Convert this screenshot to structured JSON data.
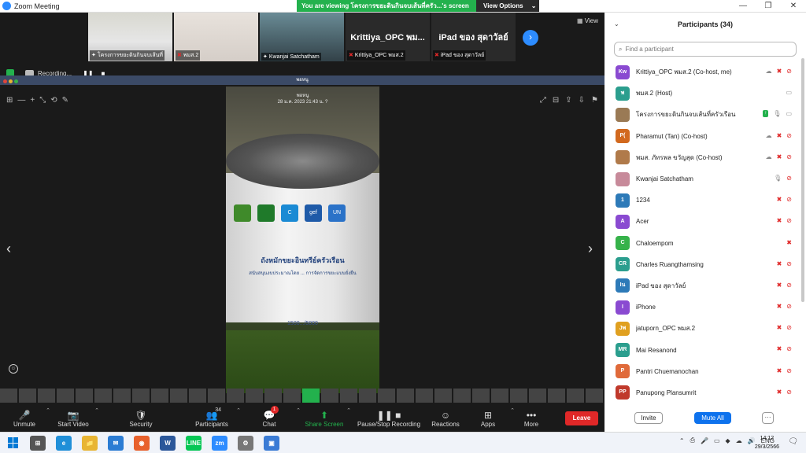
{
  "window": {
    "title": "Zoom Meeting",
    "controls": [
      "—",
      "❐",
      "✕"
    ]
  },
  "share_banner": {
    "message": "You are viewing โครงการขยะดินกินจบเส้นที่ครัว...'s screen",
    "options_label": "View Options",
    "options_caret": "⌄"
  },
  "thumbnails": [
    {
      "label": "โครงการขยะดินกินจบเส้นที่",
      "muted": false
    },
    {
      "label": "พมส.2",
      "muted": true
    },
    {
      "label": "Kwanjai Satchatham",
      "muted": false
    },
    {
      "label": "Krittiya_OPC พมส.2",
      "big_name": "Krittiya_OPC พม...",
      "muted": true
    },
    {
      "label": "iPad ของ สุดาวัลย์",
      "big_name": "iPad ของ สุดาวัลย์",
      "muted": true
    }
  ],
  "thumb_next": "›",
  "view_button": "▦ View",
  "recording": {
    "label": "Recording...",
    "pause": "❚❚",
    "stop": "■"
  },
  "share_title": "พอหนู",
  "shared_caption": {
    "line1": "พอหนู",
    "line2": "28 ม.ค. 2023 21:43 น. ?"
  },
  "bucket": {
    "title": "ถังหมักขยะอินทรีย์ครัวเรือน",
    "subtitle": "สนับสนุนงบประมาณโดย ... การจัดการขยะแบบยั่งยืน",
    "number": "1500.../5000",
    "logos": [
      "gef",
      "C",
      "UN"
    ]
  },
  "share_tools_left": [
    "⊞",
    "—",
    "+",
    "⤡",
    "⟲",
    "✎"
  ],
  "share_tools_right": [
    "⤢",
    "⊟",
    "⇪",
    "⇩",
    "⚑"
  ],
  "nav_left": "‹",
  "nav_right": "›",
  "emoji": "☺",
  "toolbar": {
    "items": [
      {
        "icon": "🎤",
        "label": "Unmute",
        "red": true,
        "caret": "⌃"
      },
      {
        "icon": "📷",
        "label": "Start Video",
        "red": true,
        "caret": "⌃"
      },
      {
        "icon": "🛡",
        "label": "Security"
      },
      {
        "icon": "👥",
        "label": "Participants",
        "count": "34",
        "caret": "⌃"
      },
      {
        "icon": "💬",
        "label": "Chat",
        "badge": "1",
        "caret": "⌃"
      },
      {
        "icon": "⬆",
        "label": "Share Screen",
        "green": true,
        "caret": "⌃"
      },
      {
        "icon": "❚❚ ■",
        "label": "Pause/Stop Recording"
      },
      {
        "icon": "☺",
        "label": "Reactions"
      },
      {
        "icon": "⊞",
        "label": "Apps",
        "caret": "⌃"
      },
      {
        "icon": "•••",
        "label": "More"
      }
    ],
    "leave_label": "Leave"
  },
  "participants_panel": {
    "title": "Participants (34)",
    "collapse": "⌄",
    "search_placeholder": "Find a participant",
    "search_icon": "⌕",
    "participants": [
      {
        "initials": "Kw",
        "name": "Krittiya_OPC พมส.2 (Co-host, me)",
        "color": "#8a4ad1",
        "icons": [
          "cloud",
          "mic-off",
          "video-off"
        ]
      },
      {
        "initials": "พ",
        "name": "พมส.2 (Host)",
        "color": "#2b9e8e",
        "icons": [
          "video"
        ]
      },
      {
        "initials": "",
        "name": "โครงการขยะดินกินจบเส้นที่ครัวเรือน",
        "color": "#9a7a55",
        "icons": [
          "share",
          "mic",
          "video"
        ]
      },
      {
        "initials": "P(",
        "name": "Pharamut (Tan) (Co-host)",
        "color": "#d2691e",
        "icons": [
          "cloud",
          "mic-off",
          "video-off"
        ]
      },
      {
        "initials": "",
        "name": "พมส. ภัทรพล ขวัญสุด (Co-host)",
        "color": "#b07a4a",
        "icons": [
          "cloud",
          "mic-off",
          "video-off"
        ]
      },
      {
        "initials": "",
        "name": "Kwanjai Satchatham",
        "color": "#c78a9a",
        "icons": [
          "mic",
          "video-off"
        ]
      },
      {
        "initials": "1",
        "name": "1234",
        "color": "#2d7ab8",
        "icons": [
          "mic-off",
          "video-off"
        ]
      },
      {
        "initials": "A",
        "name": "Acer",
        "color": "#8a4ad1",
        "icons": [
          "mic-off",
          "video-off"
        ]
      },
      {
        "initials": "C",
        "name": "Chaloempom",
        "color": "#36b24a",
        "icons": [
          "mic-off"
        ]
      },
      {
        "initials": "CR",
        "name": "Charles Ruangthamsing",
        "color": "#2b9e8e",
        "icons": [
          "mic-off",
          "video-off"
        ]
      },
      {
        "initials": "Iน",
        "name": "iPad ของ สุดาวัลย์",
        "color": "#2d7ab8",
        "icons": [
          "mic-off",
          "video-off"
        ]
      },
      {
        "initials": "I",
        "name": "iPhone",
        "color": "#8a4ad1",
        "icons": [
          "mic-off",
          "video-off"
        ]
      },
      {
        "initials": "Jพ",
        "name": "jatuporn_OPC พมส.2",
        "color": "#e0a020",
        "icons": [
          "mic-off",
          "video-off"
        ]
      },
      {
        "initials": "MR",
        "name": "Mai Resanond",
        "color": "#2b9e8e",
        "icons": [
          "mic-off",
          "video-off"
        ]
      },
      {
        "initials": "P",
        "name": "Pantri Chuemanochan",
        "color": "#e06a3a",
        "icons": [
          "mic-off",
          "video-off"
        ]
      },
      {
        "initials": "PP",
        "name": "Panupong Plansumrit",
        "color": "#c0392b",
        "icons": [
          "mic-off",
          "video-off"
        ]
      }
    ],
    "invite_label": "Invite",
    "mute_all_label": "Mute All",
    "more_label": "···"
  },
  "taskbar": {
    "apps": [
      {
        "label": "⊞",
        "color": "#555"
      },
      {
        "label": "e",
        "color": "#1f8fd8"
      },
      {
        "label": "📁",
        "color": "#e8b533"
      },
      {
        "label": "✉",
        "color": "#2b7cd3"
      },
      {
        "label": "◉",
        "color": "#e8612c"
      },
      {
        "label": "W",
        "color": "#2b579a"
      },
      {
        "label": "LINE",
        "color": "#06c755"
      },
      {
        "label": "zm",
        "color": "#2d8cff"
      },
      {
        "label": "⚙",
        "color": "#777"
      },
      {
        "label": "▣",
        "color": "#3a7bd5"
      }
    ],
    "tray": [
      "⌃",
      "⎙",
      "🎤",
      "▭",
      "◆",
      "☁",
      "🔊",
      "ENG"
    ],
    "time": "14:12",
    "date": "29/3/2566",
    "notif": "🗨"
  }
}
